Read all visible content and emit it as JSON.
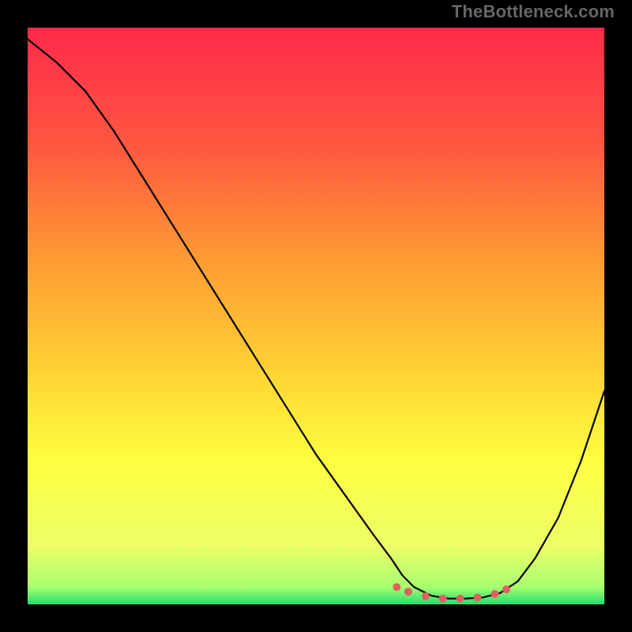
{
  "watermark": "TheBottleneck.com",
  "chart_data": {
    "type": "heatmap",
    "title": "",
    "xlabel": "",
    "ylabel": "",
    "xlim": [
      0,
      100
    ],
    "ylim": [
      0,
      100
    ],
    "gradient_stops": [
      {
        "offset": 0.0,
        "color": "#ff2a4a"
      },
      {
        "offset": 0.2,
        "color": "#ff5640"
      },
      {
        "offset": 0.4,
        "color": "#ff9a33"
      },
      {
        "offset": 0.6,
        "color": "#ffd433"
      },
      {
        "offset": 0.75,
        "color": "#ffff40"
      },
      {
        "offset": 0.9,
        "color": "#ecff66"
      },
      {
        "offset": 0.97,
        "color": "#a8ff70"
      },
      {
        "offset": 1.0,
        "color": "#20e070"
      }
    ],
    "curve": {
      "x": [
        0,
        5,
        10,
        15,
        20,
        25,
        30,
        35,
        40,
        45,
        50,
        55,
        60,
        63,
        65,
        67,
        70,
        73,
        76,
        79,
        82,
        85,
        88,
        92,
        96,
        100
      ],
      "y": [
        98,
        94,
        89,
        82,
        74,
        66,
        58,
        50,
        42,
        34,
        26,
        19,
        12,
        8,
        5,
        3,
        1.5,
        1,
        1,
        1.2,
        2,
        4,
        8,
        15,
        25,
        37
      ]
    },
    "floor_marks": {
      "x": [
        64,
        66,
        69,
        72,
        75,
        78,
        81,
        83
      ],
      "y": [
        3,
        2.2,
        1.4,
        1.0,
        1.0,
        1.2,
        1.8,
        2.6
      ]
    },
    "marker_color": "#e06060",
    "curve_color": "#000000",
    "curve_width": 2.2,
    "marker_radius": 5
  }
}
